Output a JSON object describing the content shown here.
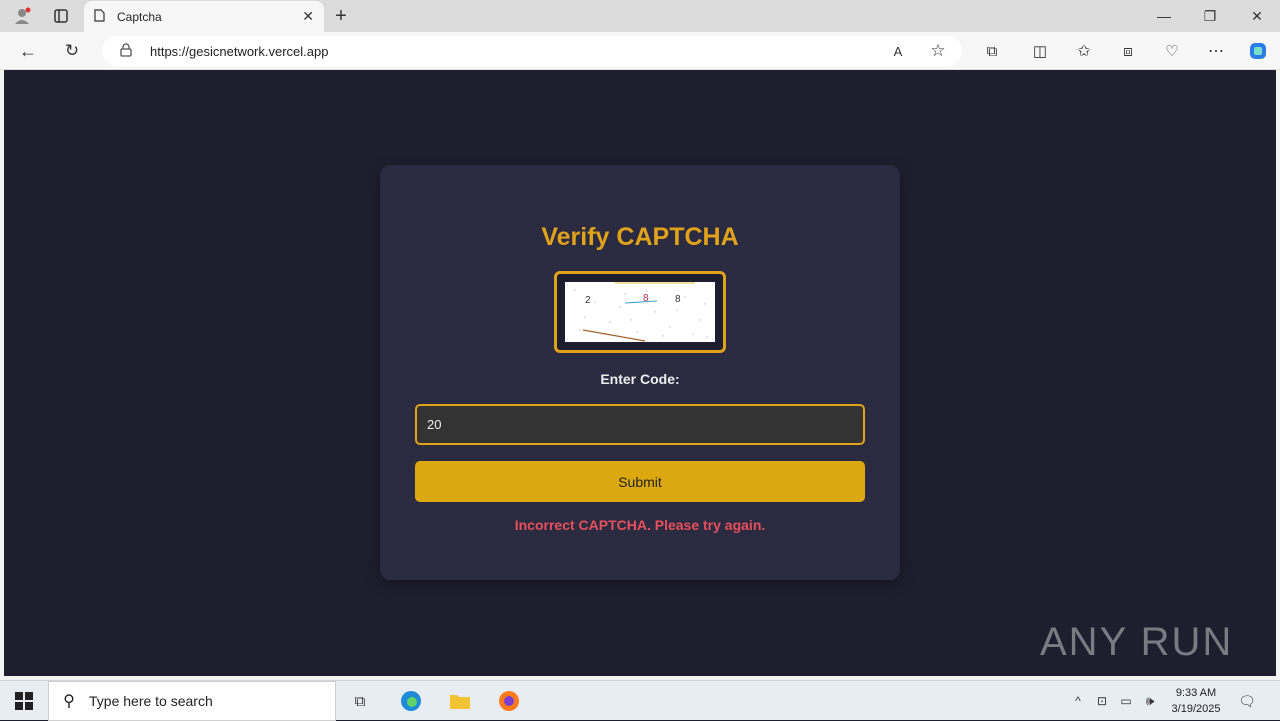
{
  "browser": {
    "tab_title": "Captcha",
    "url": "https://gesicnetwork.vercel.app"
  },
  "page": {
    "heading": "Verify CAPTCHA",
    "captcha_chars": [
      "2",
      "8",
      "8"
    ],
    "enter_code_label": "Enter Code:",
    "input_value": "20",
    "submit_label": "Submit",
    "error_message": "Incorrect CAPTCHA. Please try again."
  },
  "watermark": "ANY RUN",
  "taskbar": {
    "search_placeholder": "Type here to search",
    "time": "9:33 AM",
    "date": "3/19/2025"
  },
  "colors": {
    "accent": "#e0a21a",
    "error": "#e8505b",
    "background": "#1e1e2e",
    "card": "#2a2a40"
  }
}
